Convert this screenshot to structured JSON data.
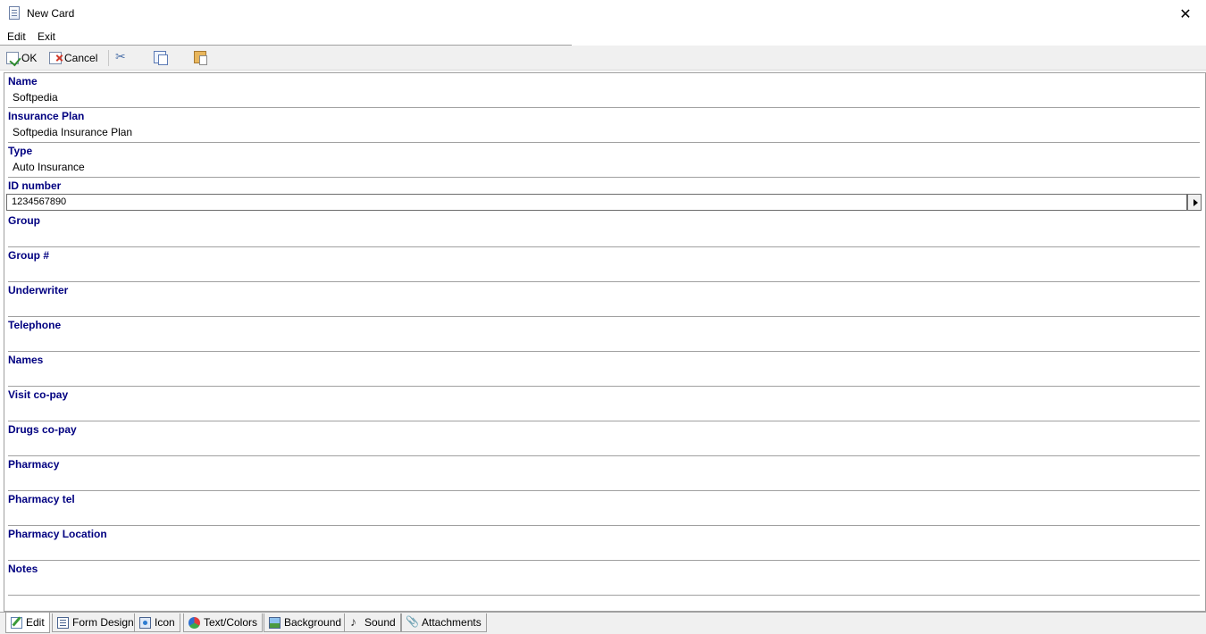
{
  "window": {
    "title": "New Card",
    "close_glyph": "✕"
  },
  "menu": {
    "items": [
      "Edit",
      "Exit"
    ]
  },
  "toolbar": {
    "ok_label": "OK",
    "cancel_label": "Cancel",
    "icons": [
      "ok-icon",
      "cancel-icon",
      "cut-icon",
      "copy-icon",
      "paste-icon"
    ]
  },
  "fields": [
    {
      "label": "Name",
      "value": "Softpedia"
    },
    {
      "label": "Insurance Plan",
      "value": "Softpedia Insurance Plan"
    },
    {
      "label": "Type",
      "value": "Auto Insurance"
    },
    {
      "label": "ID number",
      "value": "1234567890"
    },
    {
      "label": "Group",
      "value": ""
    },
    {
      "label": "Group #",
      "value": ""
    },
    {
      "label": "Underwriter",
      "value": ""
    },
    {
      "label": "Telephone",
      "value": ""
    },
    {
      "label": "Names",
      "value": ""
    },
    {
      "label": "Visit co-pay",
      "value": ""
    },
    {
      "label": "Drugs co-pay",
      "value": ""
    },
    {
      "label": "Pharmacy",
      "value": ""
    },
    {
      "label": "Pharmacy tel",
      "value": ""
    },
    {
      "label": "Pharmacy Location",
      "value": ""
    },
    {
      "label": "Notes",
      "value": ""
    }
  ],
  "tabs": [
    {
      "label": "Edit",
      "icon": "edit-icon",
      "active": true
    },
    {
      "label": "Form Design",
      "icon": "form-design-icon",
      "active": false
    },
    {
      "label": "Icon",
      "icon": "icon-icon",
      "active": false
    },
    {
      "label": "Text/Colors",
      "icon": "colors-icon",
      "active": false
    },
    {
      "label": "Background",
      "icon": "background-icon",
      "active": false
    },
    {
      "label": "Sound",
      "icon": "sound-icon",
      "active": false
    },
    {
      "label": "Attachments",
      "icon": "attachments-icon",
      "active": false
    }
  ],
  "colors": {
    "label_color": "#000080",
    "toolbar_bg": "#f0f0f0",
    "divider": "#a0a0a0"
  }
}
